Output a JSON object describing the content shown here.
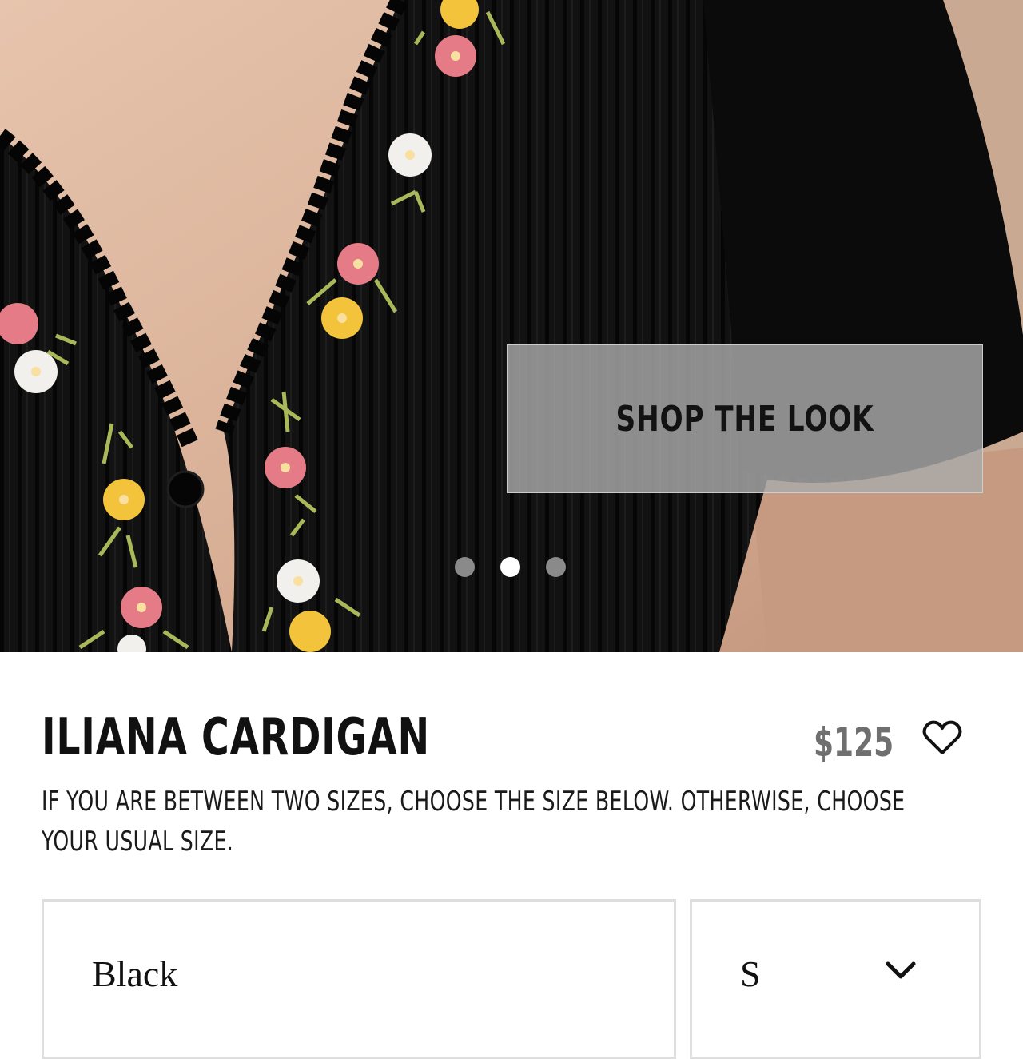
{
  "hero": {
    "cta_label": "SHOP THE LOOK",
    "carousel": {
      "count": 3,
      "active_index": 1
    }
  },
  "product": {
    "title": "ILIANA CARDIGAN",
    "price": "$125",
    "size_note": "IF YOU ARE BETWEEN TWO SIZES, CHOOSE THE SIZE BELOW. OTHERWISE, CHOOSE YOUR USUAL SIZE."
  },
  "options": {
    "color": {
      "selected": "Black"
    },
    "size": {
      "selected": "S"
    }
  },
  "icons": {
    "wishlist": "heart-outline-icon",
    "dropdown": "chevron-down-icon"
  },
  "colors": {
    "knit": "#101010",
    "skin": "#dcb59c",
    "overlay": "#aaaaaa",
    "price": "#6f6f6f",
    "border": "#dedede"
  }
}
